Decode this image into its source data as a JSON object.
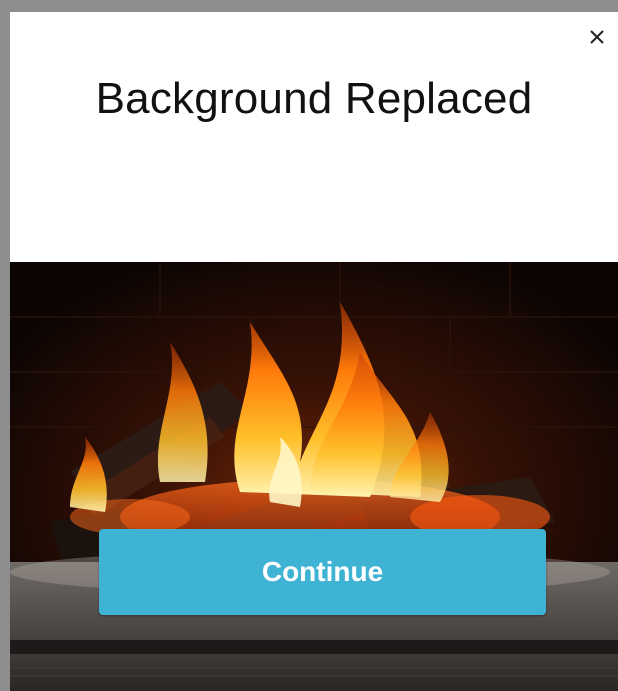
{
  "dialog": {
    "title": "Background Replaced",
    "close_icon": "close-icon",
    "image_icon": "fireplace-image",
    "continue_label": "Continue"
  },
  "colors": {
    "button_bg": "#3fb3d3",
    "button_text": "#ffffff",
    "title_text": "#111111",
    "frame_border": "#8e8e8e"
  }
}
